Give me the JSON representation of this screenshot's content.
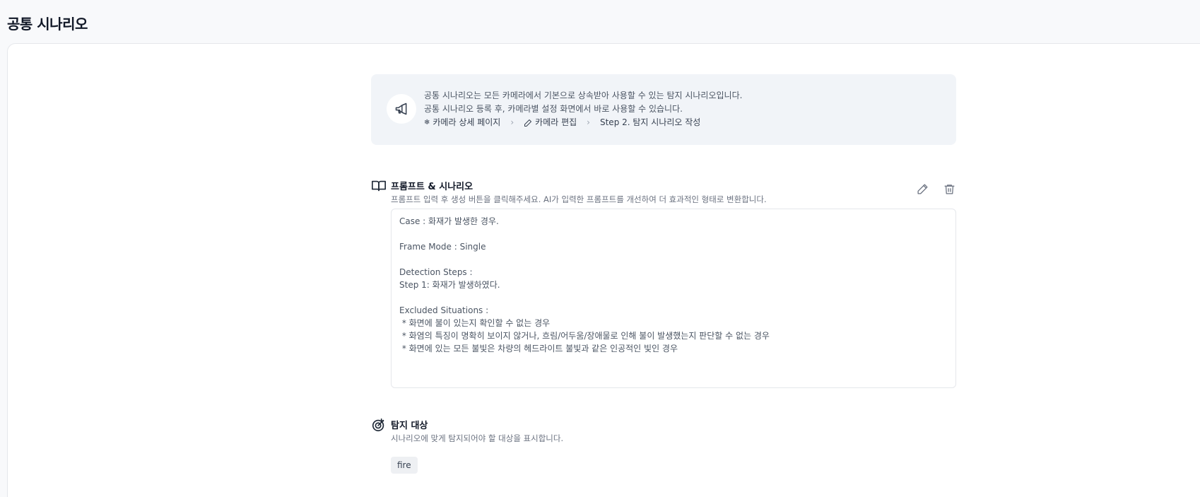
{
  "page": {
    "title": "공통 시나리오"
  },
  "info": {
    "icon": "megaphone-icon",
    "line1": "공통 시나리오는 모든 카메라에서 기본으로 상속받아 사용할 수 있는 탐지 시나리오입니다.",
    "line2": "공통 시나리오 등록 후, 카메라별 설정 화면에서 바로 사용할 수 있습니다.",
    "breadcrumb": [
      {
        "icon": "snowflake-icon",
        "label": "카메라 상세 페이지"
      },
      {
        "icon": "pencil-icon",
        "label": "카메라 편집"
      },
      {
        "icon": "",
        "label": "Step 2. 탐지 시나리오 작성"
      }
    ],
    "separator": "›"
  },
  "prompt_section": {
    "icon": "book-icon",
    "title": "프롬프트 & 시나리오",
    "description": "프롬프트 입력 후 생성 버튼을 클릭해주세요. AI가 입력한 프롬프트를 개선하여 더 효과적인 형태로 변환합니다.",
    "content": "Case : 화재가 발생한 경우.\n\nFrame Mode : Single\n\nDetection Steps :\nStep 1: 화재가 발생하였다.\n\nExcluded Situations :\n * 화면에 불이 있는지 확인할 수 없는 경우\n * 화염의 특징이 명확히 보이지 않거나, 흐림/어두움/장애물로 인해 불이 발생했는지 판단할 수 없는 경우\n * 화면에 있는 모든 불빛은 차량의 헤드라이트 불빛과 같은 인공적인 빛인 경우",
    "edit_icon": "pencil-icon",
    "delete_icon": "trash-icon"
  },
  "target_section": {
    "icon": "target-icon",
    "title": "탐지 대상",
    "description": "시나리오에 맞게 탐지되어야 할 대상을 표시합니다.",
    "targets": [
      "fire"
    ]
  }
}
